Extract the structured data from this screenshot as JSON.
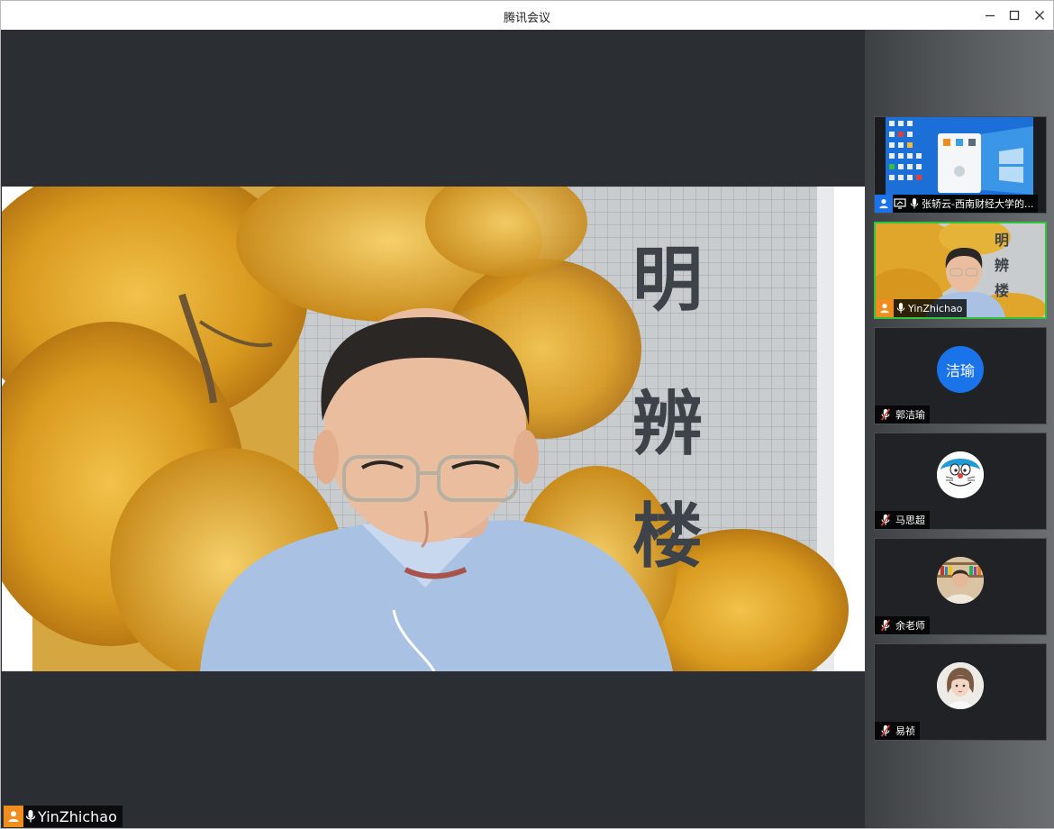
{
  "window": {
    "title": "腾讯会议"
  },
  "main_video": {
    "speaker_name": "YinZhichao",
    "sign_chars": [
      "明",
      "辨",
      "楼"
    ]
  },
  "participants": [
    {
      "name": "张轿云-西南财经大学的...",
      "kind": "screen-share"
    },
    {
      "name": "YinZhichao",
      "kind": "video",
      "sign_chars": [
        "明",
        "辨",
        "楼"
      ]
    },
    {
      "name": "郭洁瑜",
      "kind": "avatar-text",
      "avatar_text": "洁瑜"
    },
    {
      "name": "马思超",
      "kind": "avatar-image",
      "avatar": "doraemon-avatar"
    },
    {
      "name": "余老师",
      "kind": "avatar-image",
      "avatar": "bookshelf-avatar"
    },
    {
      "name": "易祯",
      "kind": "avatar-image",
      "avatar": "girl-avatar"
    }
  ],
  "colors": {
    "host_badge": "#f08d1f",
    "active_speaker_border": "#33c23d",
    "avatar_blue": "#1a73e8",
    "muted_red": "#e0403a"
  }
}
